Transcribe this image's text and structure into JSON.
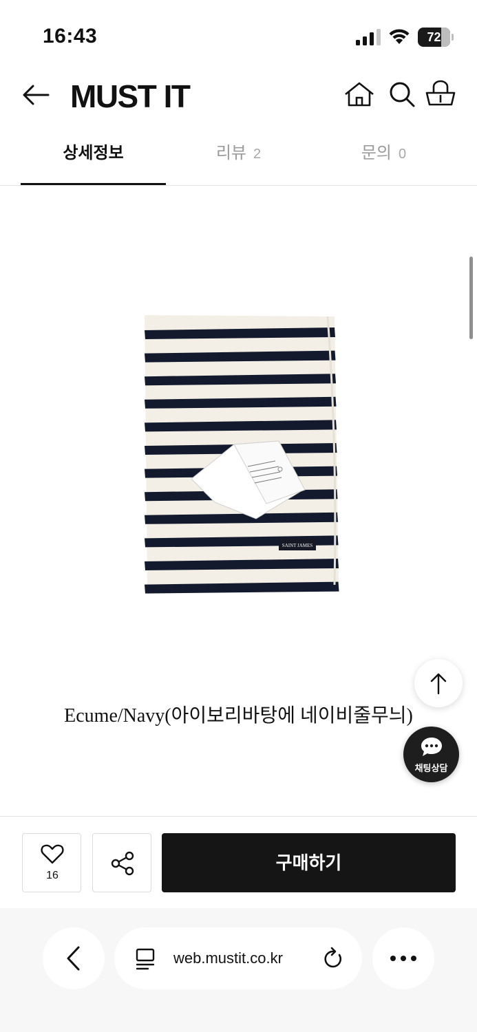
{
  "status_bar": {
    "time": "16:43",
    "battery": "72",
    "battery_level": 0.72
  },
  "header": {
    "brand": "MUST IT",
    "icons": [
      "back-arrow-icon",
      "home-icon",
      "search-icon",
      "shopping-bag-icon"
    ]
  },
  "tabs": [
    {
      "label": "상세정보",
      "count": "",
      "active": true
    },
    {
      "label": "리뷰",
      "count": "2",
      "active": false
    },
    {
      "label": "문의",
      "count": "0",
      "active": false
    }
  ],
  "product": {
    "color_caption": "Ecume/Navy(아이보리바탕에 네이비줄무늬)",
    "stripe_colors": {
      "base": "#f3efe6",
      "stripe": "#141a2e"
    },
    "label_text": "SAINT JAMES"
  },
  "floating": {
    "scroll_top_icon": "arrow-up-icon",
    "chat_label": "채팅상담"
  },
  "action_bar": {
    "like_count": "16",
    "buy_label": "구매하기"
  },
  "browser": {
    "url": "web.mustit.co.kr"
  }
}
